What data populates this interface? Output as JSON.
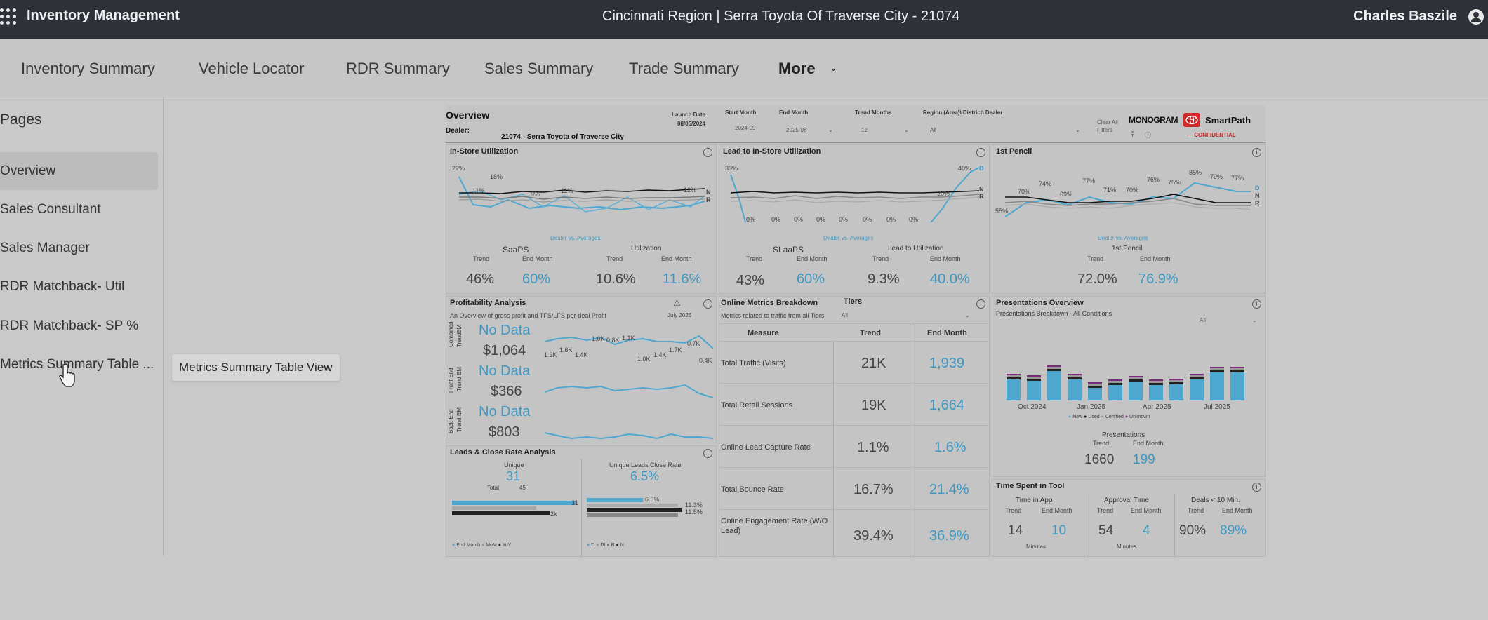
{
  "topbar": {
    "app_title": "Inventory Management",
    "region": "Cincinnati Region |   Serra Toyota Of Traverse City - 21074",
    "user": "Charles Baszile",
    "icons": [
      "apps-grid-icon",
      "user-icon"
    ]
  },
  "nav": {
    "tabs": [
      "Inventory Summary",
      "Vehicle Locator",
      "RDR Summary",
      "Sales Summary",
      "Trade Summary"
    ],
    "more": "More"
  },
  "sidebar": {
    "title": "Pages",
    "items": [
      {
        "label": "Overview",
        "selected": true
      },
      {
        "label": "Sales Consultant"
      },
      {
        "label": "Sales Manager"
      },
      {
        "label": "RDR Matchback- Util"
      },
      {
        "label": "RDR Matchback- SP %"
      },
      {
        "label": "Metrics Summary Table ..."
      }
    ],
    "tooltip": "Metrics Summary Table View"
  },
  "report": {
    "title": "Overview",
    "dealer_label": "Dealer:",
    "dealer": "21074 - Serra Toyota of Traverse City",
    "launch_date_label": "Launch Date",
    "launch_date": "08/05/2024",
    "filters": {
      "start_month_label": "Start Month",
      "start_month": "2024-09",
      "end_month_label": "End Month",
      "end_month": "2025-08",
      "trend_months_label": "Trend Months",
      "trend_months": "12",
      "region_label": "Region (Area)\\ District\\ Dealer",
      "region": "All",
      "clear_all": "Clear All Filters"
    },
    "brand": {
      "monogram": "MONOGRAM",
      "smartpath": "SmartPath",
      "confidential": "— CONFIDENTIAL"
    },
    "dealer_vs_avg": "Dealer vs. Averages",
    "trend_label": "Trend",
    "end_month_label": "End Month",
    "in_store": {
      "title": "In-Store Utilization",
      "labels": [
        "22%",
        "11%",
        "18%",
        "9%",
        "11%",
        "12%"
      ],
      "left_head": "SaaPS",
      "right_head": "Utilization",
      "values": [
        "46%",
        "60%",
        "10.6%",
        "11.6%"
      ]
    },
    "lead_in_store": {
      "title": "Lead to In-Store Utilization",
      "labels": [
        "33%",
        "0%",
        "0%",
        "0%",
        "0%",
        "0%",
        "0%",
        "0%",
        "0%",
        "20%",
        "40%"
      ],
      "left_head": "SLaaPS",
      "right_head": "Lead to Utilization",
      "values": [
        "43%",
        "60%",
        "9.3%",
        "40.0%"
      ]
    },
    "first_pencil": {
      "title": "1st Pencil",
      "labels": [
        "55%",
        "70%",
        "74%",
        "69%",
        "77%",
        "71%",
        "70%",
        "76%",
        "75%",
        "85%",
        "79%",
        "77%"
      ],
      "head": "1st Pencil",
      "values": [
        "72.0%",
        "76.9%"
      ]
    },
    "series_tags": [
      "D",
      "N",
      "R"
    ],
    "profitability": {
      "title": "Profitability Analysis",
      "subtitle": "An Overview of gross profit and TFS/LFS per-deal Profit",
      "month": "July 2025",
      "rows": [
        {
          "group": "Combined",
          "no_data": "No Data",
          "value": "$1,064"
        },
        {
          "group": "Front-End",
          "no_data": "No Data",
          "value": "$366"
        },
        {
          "group": "Back-End",
          "no_data": "No Data",
          "value": "$803"
        }
      ],
      "em": "EM",
      "trend": "Trend",
      "point_labels": [
        "1.3K",
        "1.6K",
        "1.4K",
        "1.0K",
        "0.8K",
        "1.1K",
        "1.0K",
        "1.4K",
        "1.7K",
        "0.7K",
        "0.4K"
      ]
    },
    "online": {
      "title": "Online Metrics Breakdown",
      "tiers": "Tiers",
      "subtitle": "Metrics related to traffic from all Tiers",
      "tier_value": "All",
      "headers": [
        "Measure",
        "Trend",
        "End Month"
      ],
      "rows": [
        {
          "measure": "Total Traffic (Visits)",
          "trend": "21K",
          "end": "1,939"
        },
        {
          "measure": "Total Retail Sessions",
          "trend": "19K",
          "end": "1,664"
        },
        {
          "measure": "Online Lead Capture Rate",
          "trend": "1.1%",
          "end": "1.6%"
        },
        {
          "measure": "Total Bounce Rate",
          "trend": "16.7%",
          "end": "21.4%"
        },
        {
          "measure": "Online Engagement Rate (W/O Lead)",
          "trend": "39.4%",
          "end": "36.9%"
        }
      ]
    },
    "presentations": {
      "title": "Presentations Overview",
      "subtitle": "Presentations Breakdown - All Conditions",
      "filter": "All",
      "axis": [
        "Oct 2024",
        "Jan 2025",
        "Apr 2025",
        "Jul 2025"
      ],
      "legend": [
        "New",
        "Used",
        "Certified",
        "Unknown"
      ],
      "head": "Presentations",
      "values": [
        "1660",
        "199"
      ]
    },
    "leads": {
      "title": "Leads & Close Rate Analysis",
      "unique_label": "Unique",
      "unique": "31",
      "total_label": "Total",
      "total": "45",
      "close_label": "Unique Leads Close Rate",
      "close": "6.5%",
      "bar_labels_left": [
        "31",
        "2k"
      ],
      "bar_labels_right": [
        "6.5%",
        "11.3%",
        "11.5%"
      ],
      "legend_left": [
        "End Month",
        "MoM",
        "YoY"
      ],
      "legend_right": [
        "D",
        "DI",
        "R",
        "N"
      ]
    },
    "time": {
      "title": "Time Spent in Tool",
      "groups": [
        {
          "head": "Time in App",
          "trend": "14",
          "end": "10",
          "unit": "Minutes"
        },
        {
          "head": "Approval Time",
          "trend": "54",
          "end": "4",
          "unit": "Minutes"
        },
        {
          "head": "Deals < 10 Min.",
          "trend": "90%",
          "end": "89%"
        }
      ]
    }
  }
}
